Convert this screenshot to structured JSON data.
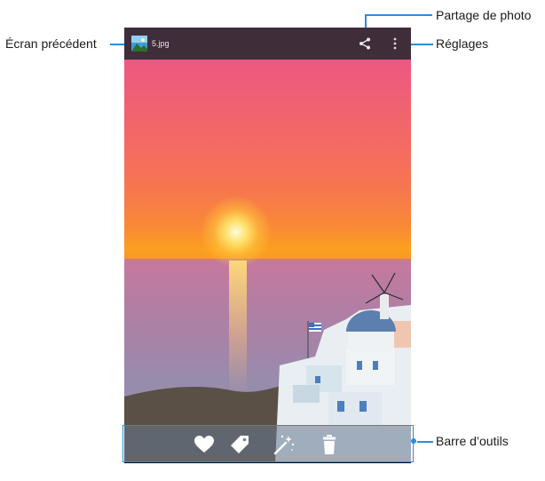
{
  "callouts": {
    "share": "Partage de photo",
    "settings": "Réglages",
    "back": "Écran précédent",
    "toolbar": "Barre d’outils"
  },
  "app_bar": {
    "filename": "5.jpg",
    "thumb_icon": "image-thumbnail-icon",
    "share_icon": "share-icon",
    "menu_icon": "overflow-menu-icon"
  },
  "toolbar": {
    "icons": [
      "heart-icon",
      "tag-icon",
      "magic-wand-icon",
      "trash-icon"
    ]
  },
  "navbar": {
    "icons": [
      "recent-up-icon",
      "back-icon",
      "home-icon",
      "recent-apps-icon"
    ]
  },
  "colors": {
    "callout": "#2a8fd6",
    "app_bar": "#28282f",
    "nav_bar": "#0b0b0d"
  }
}
